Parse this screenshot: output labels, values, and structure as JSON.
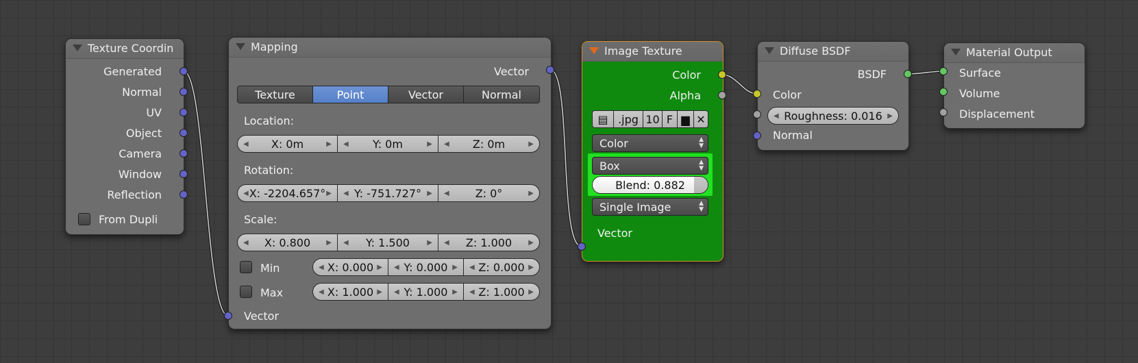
{
  "nodes": {
    "texture_coord": {
      "title": "Texture Coordin",
      "outputs": [
        "Generated",
        "Normal",
        "UV",
        "Object",
        "Camera",
        "Window",
        "Reflection"
      ],
      "from_dupli": "From Dupli"
    },
    "mapping": {
      "title": "Mapping",
      "output": "Vector",
      "tabs": [
        "Texture",
        "Point",
        "Vector",
        "Normal"
      ],
      "active_tab": "Point",
      "location_label": "Location:",
      "location": [
        "X: 0m",
        "Y: 0m",
        "Z: 0m"
      ],
      "rotation_label": "Rotation:",
      "rotation": [
        "X: -2204.657°",
        "Y: -751.727°",
        "Z: 0°"
      ],
      "scale_label": "Scale:",
      "scale": [
        "X: 0.800",
        "Y: 1.500",
        "Z: 1.000"
      ],
      "min_label": "Min",
      "min": [
        "X: 0.000",
        "Y: 0.000",
        "Z: 0.000"
      ],
      "max_label": "Max",
      "max": [
        "X: 1.000",
        "Y: 1.000",
        "Z: 1.000"
      ],
      "input": "Vector"
    },
    "image_texture": {
      "title": "Image Texture",
      "outputs": [
        "Color",
        "Alpha"
      ],
      "image_ext": ".jpg",
      "image_users": "10",
      "image_fake": "F",
      "color_space": "Color",
      "projection": "Box",
      "blend": "Blend: 0.882",
      "blend_value": 0.882,
      "source": "Single Image",
      "input": "Vector",
      "background_color": "#0f8a0f",
      "highlight_color": "#22e022"
    },
    "diffuse_bsdf": {
      "title": "Diffuse BSDF",
      "output": "BSDF",
      "input_color": "Color",
      "roughness": "Roughness: 0.016",
      "input_normal": "Normal"
    },
    "material_output": {
      "title": "Material Output",
      "inputs": [
        "Surface",
        "Volume",
        "Displacement"
      ]
    }
  },
  "colors": {
    "vector_socket": "#6363c7",
    "color_socket": "#c7c729",
    "shader_socket": "#63c763",
    "value_socket": "#a1a1a1",
    "active_tab": "#5680c8"
  }
}
